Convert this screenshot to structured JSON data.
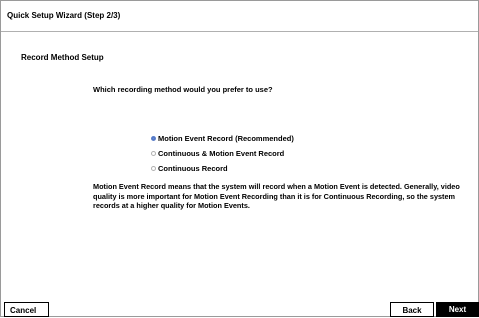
{
  "wizard": {
    "title": "Quick Setup Wizard (Step 2/3)"
  },
  "section": {
    "title": "Record Method Setup",
    "question": "Which recording method would you prefer to use?"
  },
  "options": [
    {
      "label": "Motion Event Record (Recommended)",
      "selected": true
    },
    {
      "label": "Continuous & Motion Event Record",
      "selected": false
    },
    {
      "label": "Continuous Record",
      "selected": false
    }
  ],
  "description": "Motion Event Record means that the system will record when a Motion Event is detected. Generally, video quality is more important for Motion Event Recording than it is for Continuous Recording, so the system records at a higher quality for Motion Events.",
  "buttons": {
    "cancel": "Cancel",
    "back": "Back",
    "next": "Next"
  },
  "colors": {
    "radio_selected": "#5b7ec8",
    "next_button_bg": "#000000"
  }
}
